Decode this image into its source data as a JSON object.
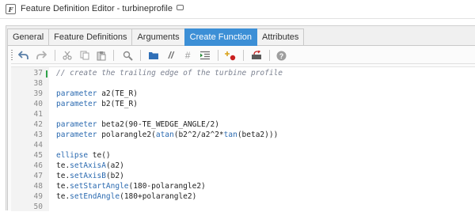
{
  "window": {
    "app_icon_letter": "F",
    "title": "Feature Definition Editor - turbineprofile"
  },
  "tabs": [
    {
      "label": "General",
      "active": false
    },
    {
      "label": "Feature Definitions",
      "active": false
    },
    {
      "label": "Arguments",
      "active": false
    },
    {
      "label": "Create Function",
      "active": true
    },
    {
      "label": "Attributes",
      "active": false
    }
  ],
  "toolbar": {
    "icons": [
      "undo-icon",
      "redo-icon",
      "cut-icon",
      "copy-icon",
      "paste-icon",
      "find-icon",
      "folder-icon",
      "comment-icon",
      "hash-icon",
      "indent-icon",
      "insert-breakpoint-icon",
      "snippet-icon",
      "help-icon"
    ],
    "comment_glyph": "//",
    "hash_glyph": "#",
    "help_glyph": "?"
  },
  "editor": {
    "lines": [
      {
        "num": "37",
        "tokens": [
          {
            "t": "// create the trailing edge of the turbine profile",
            "c": "cmt"
          }
        ]
      },
      {
        "num": "38",
        "tokens": []
      },
      {
        "num": "39",
        "tokens": [
          {
            "t": "parameter",
            "c": "kw"
          },
          {
            "t": " a2(TE_R)",
            "c": "txt"
          }
        ]
      },
      {
        "num": "40",
        "tokens": [
          {
            "t": "parameter",
            "c": "kw"
          },
          {
            "t": " b2(TE_R)",
            "c": "txt"
          }
        ]
      },
      {
        "num": "41",
        "tokens": []
      },
      {
        "num": "42",
        "tokens": [
          {
            "t": "parameter",
            "c": "kw"
          },
          {
            "t": " beta2(90-TE_WEDGE_ANGLE/2)",
            "c": "txt"
          }
        ]
      },
      {
        "num": "43",
        "tokens": [
          {
            "t": "parameter",
            "c": "kw"
          },
          {
            "t": " polarangle2(",
            "c": "txt"
          },
          {
            "t": "atan",
            "c": "fn"
          },
          {
            "t": "(b2^2/a2^2*",
            "c": "txt"
          },
          {
            "t": "tan",
            "c": "fn"
          },
          {
            "t": "(beta2)))",
            "c": "txt"
          }
        ]
      },
      {
        "num": "44",
        "tokens": []
      },
      {
        "num": "45",
        "tokens": [
          {
            "t": "ellipse",
            "c": "kw"
          },
          {
            "t": " te()",
            "c": "txt"
          }
        ]
      },
      {
        "num": "46",
        "tokens": [
          {
            "t": "te.",
            "c": "txt"
          },
          {
            "t": "setAxisA",
            "c": "fn"
          },
          {
            "t": "(a2)",
            "c": "txt"
          }
        ]
      },
      {
        "num": "47",
        "tokens": [
          {
            "t": "te.",
            "c": "txt"
          },
          {
            "t": "setAxisB",
            "c": "fn"
          },
          {
            "t": "(b2)",
            "c": "txt"
          }
        ]
      },
      {
        "num": "48",
        "tokens": [
          {
            "t": "te.",
            "c": "txt"
          },
          {
            "t": "setStartAngle",
            "c": "fn"
          },
          {
            "t": "(180-polarangle2)",
            "c": "txt"
          }
        ]
      },
      {
        "num": "49",
        "tokens": [
          {
            "t": "te.",
            "c": "txt"
          },
          {
            "t": "setEndAngle",
            "c": "fn"
          },
          {
            "t": "(180+polarangle2)",
            "c": "txt"
          }
        ]
      },
      {
        "num": "50",
        "tokens": []
      }
    ]
  },
  "colors": {
    "active_tab": "#3c8fd6",
    "keyword": "#2b6ab0",
    "comment": "#7b8190",
    "change_marker": "#2fa24a"
  }
}
